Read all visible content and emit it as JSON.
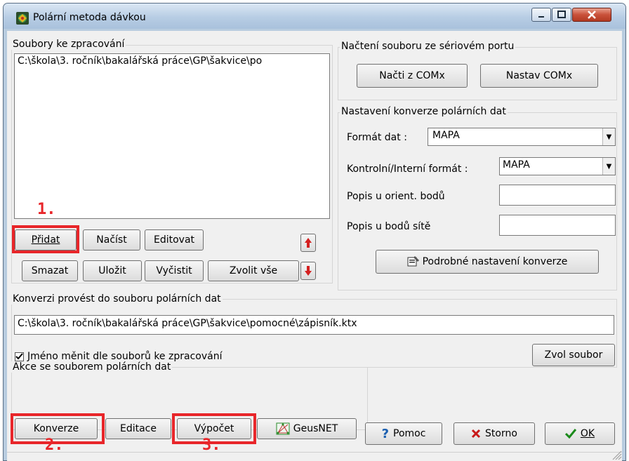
{
  "window": {
    "title": "Polární metoda dávkou"
  },
  "files_group": {
    "label": "Soubory ke zpracování",
    "items": [
      "C:\\škola\\3. ročník\\bakalářská práce\\GP\\šakvice\\po"
    ],
    "buttons": {
      "add": "Přidat",
      "load": "Načíst",
      "edit": "Editovat",
      "delete": "Smazat",
      "save": "Uložit",
      "clear": "Vyčistit",
      "select_all": "Zvolit vše"
    }
  },
  "serial_group": {
    "label": "Načtení souboru ze sériovém portu",
    "read_com": "Načti z COMx",
    "set_com": "Nastav COMx"
  },
  "conversion_settings": {
    "label": "Nastavení konverze polárních dat",
    "data_format_label": "Formát dat :",
    "data_format_value": "MAPA",
    "control_format_label": "Kontrolní/Interní formát :",
    "control_format_value": "MAPA",
    "orient_label": "Popis u orient. bodů",
    "orient_value": "",
    "grid_label": "Popis u bodů sítě",
    "grid_value": "",
    "detail_button": "Podrobné nastavení konverze"
  },
  "output_group": {
    "label": "Konverzi provést do souboru polárních dat",
    "path": "C:\\škola\\3. ročník\\bakalářská práce\\GP\\šakvice\\pomocné\\zápisník.ktx",
    "rename_checkbox": "Jméno měnit dle souborů ke zpracování",
    "rename_checked": true,
    "choose_file": "Zvol soubor"
  },
  "actions_group": {
    "label": "Akce se souborem polárních dat",
    "convert": "Konverze",
    "edit": "Editace",
    "compute": "Výpočet",
    "geusnet": "GeusNET"
  },
  "footer": {
    "help": "Pomoc",
    "cancel": "Storno",
    "ok": "OK"
  },
  "annotations": [
    "1.",
    "2.",
    "3."
  ],
  "colors": {
    "annotation": "#e8262a",
    "title_bar": "#b7cde4",
    "close_button": "#c9513a"
  }
}
